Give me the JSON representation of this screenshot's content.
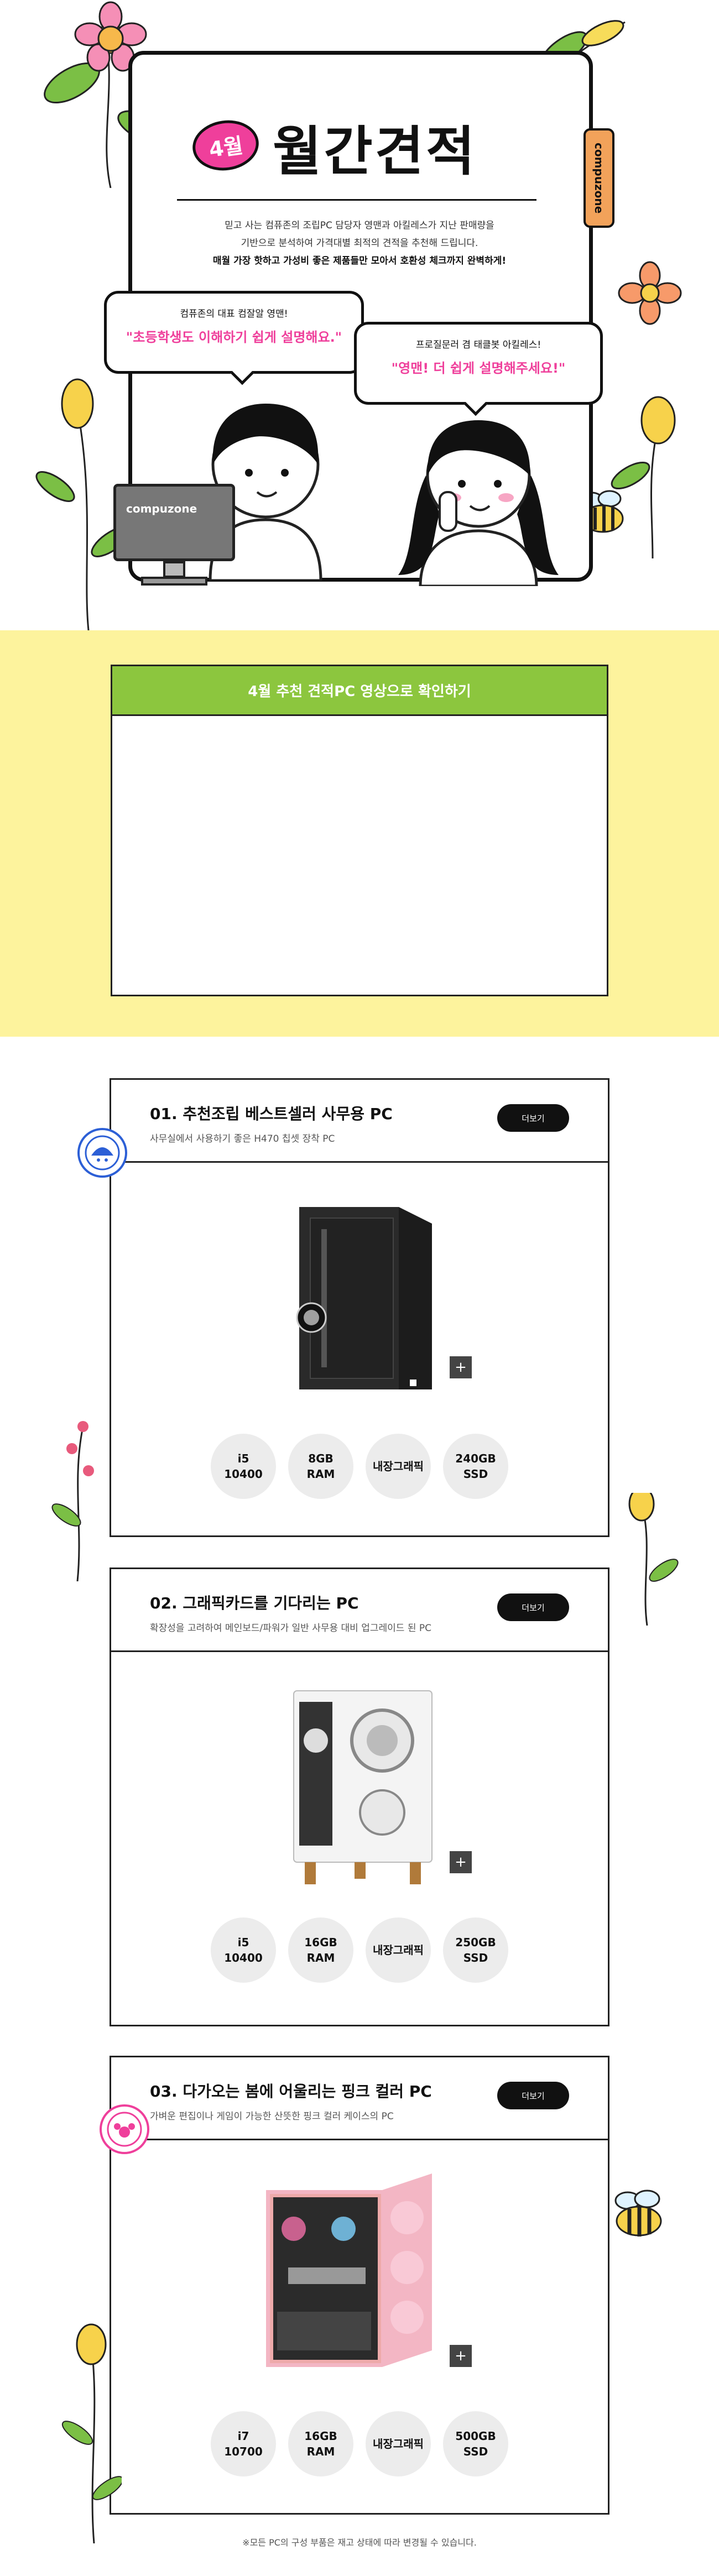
{
  "hero": {
    "month_badge": "4월",
    "title": "월간견적",
    "side_tab": "compuzone",
    "desc_line1": "믿고 사는 컴퓨존의 조립PC 담당자 영맨과 아킬레스가 지난 판매량을",
    "desc_line2": "기반으로 분석하여 가격대별 최적의 견적을 추천해 드립니다.",
    "desc_bold": "매월 가장 핫하고 가성비 좋은 제품들만 모아서 호환성 체크까지 완벽하게!",
    "bubble_left_who": "컴퓨존의 대표 컴잘알 영맨!",
    "bubble_left_quote": "\"초등학생도 이해하기 쉽게 설명해요.\"",
    "bubble_right_who": "프로질문러 겸 태클봇 아킬레스!",
    "bubble_right_quote": "\"영맨! 더 쉽게 설명해주세요!\"",
    "monitor_brand": "compuzone"
  },
  "video": {
    "heading": "4월 추천 견적PC 영상으로 확인하기"
  },
  "products": [
    {
      "title": "01. 추천조립 베스트셀러 사무용 PC",
      "subtitle": "사무실에서 사용하기 좋은 H470 칩셋 장착 PC",
      "more": "더보기",
      "plus": "+",
      "stamp": "BEST",
      "specs": [
        "i5\n10400",
        "8GB\nRAM",
        "내장그래픽",
        "240GB\nSSD"
      ]
    },
    {
      "title": "02. 그래픽카드를 기다리는 PC",
      "subtitle": "확장성을 고려하여 메인보드/파워가 일반 사무용 대비 업그레이드 된 PC",
      "more": "더보기",
      "plus": "+",
      "stamp": "",
      "specs": [
        "i5\n10400",
        "16GB\nRAM",
        "내장그래픽",
        "250GB\nSSD"
      ]
    },
    {
      "title": "03. 다가오는 봄에 어울리는 핑크 컬러 PC",
      "subtitle": "가벼운 편집이나 게임이 가능한 산뜻한 핑크 컬러 케이스의 PC",
      "more": "더보기",
      "plus": "+",
      "stamp": "SPRING",
      "specs": [
        "i7\n10700",
        "16GB\nRAM",
        "내장그래픽",
        "500GB\nSSD"
      ]
    }
  ],
  "footnote": "※모든 PC의 구성 부품은 재고 상태에 따라 변경될 수 있습니다.",
  "colors": {
    "accent_pink": "#ef3f9b",
    "video_bg": "#fdf39d",
    "video_head": "#8cc63e",
    "orange_tab": "#f2a25a"
  }
}
